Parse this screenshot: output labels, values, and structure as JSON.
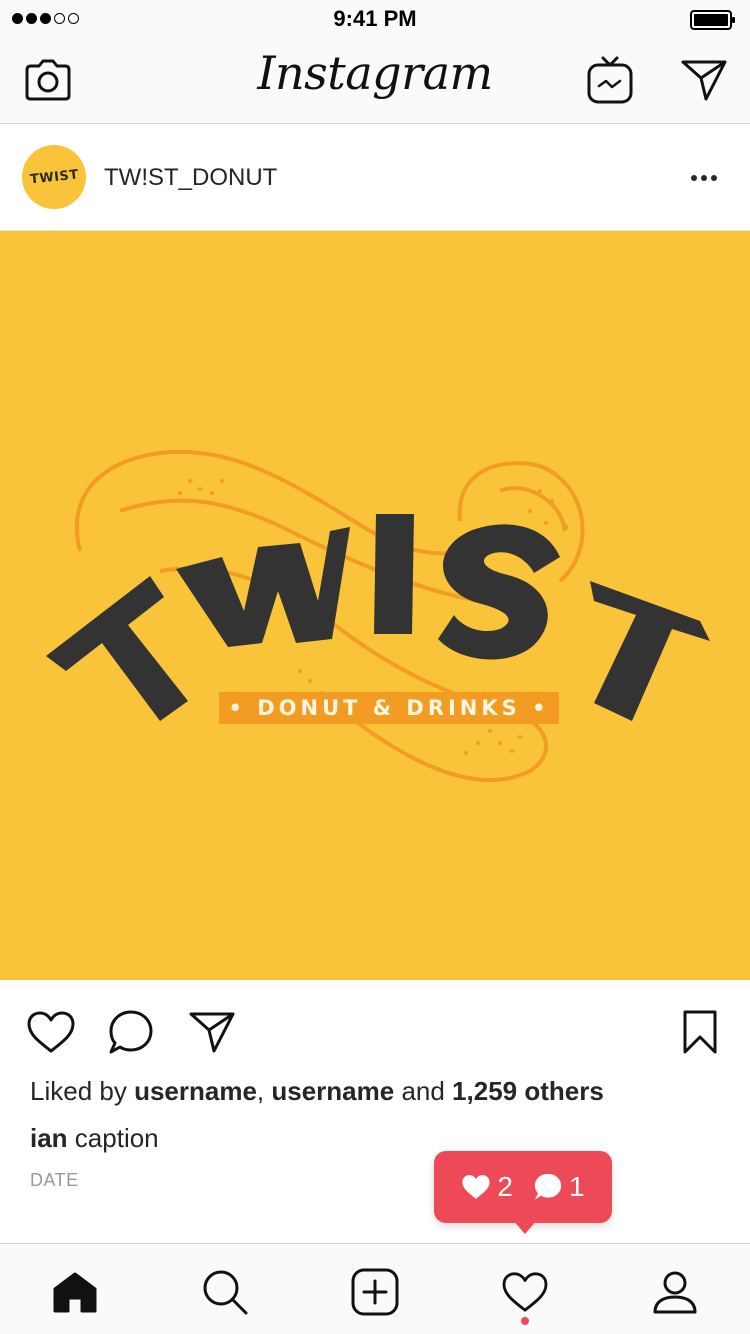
{
  "status_bar": {
    "time": "9:41 PM",
    "signal_bars_filled": 3,
    "signal_bars_total": 5
  },
  "nav": {
    "logo_text": "Instagram",
    "left_icon": "camera-icon",
    "right_icons": [
      "igtv-icon",
      "direct-message-icon"
    ]
  },
  "post": {
    "username": "TW!ST_DONUT",
    "avatar_text": "TWIST",
    "image": {
      "brand_word": "TWIST",
      "tagline": "• DONUT & DRINKS •",
      "background_color": "#f9c43a",
      "accent_color": "#f39c24",
      "letter_color": "#333333"
    },
    "likes": {
      "prefix": "Liked by ",
      "user1": "username",
      "separator": ", ",
      "user2": "username",
      "middle": " and ",
      "count": "1,259 others"
    },
    "caption": {
      "username": "ian",
      "text": " caption"
    },
    "date": "DATE"
  },
  "notification": {
    "likes": "2",
    "comments": "1",
    "color": "#ed4956"
  },
  "tabbar": {
    "tabs": [
      "home-icon",
      "search-icon",
      "add-post-icon",
      "activity-heart-icon",
      "profile-icon"
    ],
    "active": "home-icon"
  }
}
